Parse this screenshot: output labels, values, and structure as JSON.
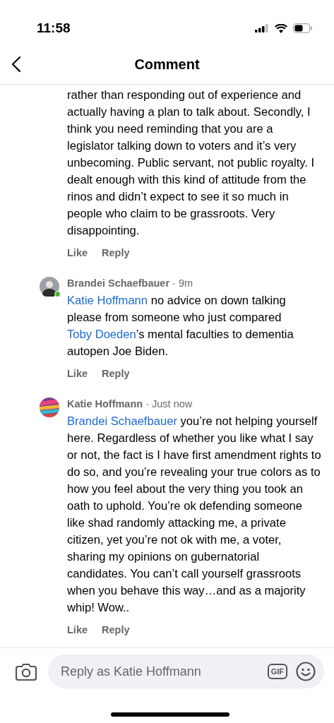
{
  "status_bar": {
    "time": "11:58"
  },
  "header": {
    "title": "Comment"
  },
  "comments": [
    {
      "body": [
        {
          "kind": "text",
          "text": "rather than responding out of experience and actually having a plan to talk about. Secondly, I think you need reminding that you are a legislator talking down to voters and it’s very unbecoming. Public servant, not public royalty. I dealt enough with this kind of attitude from the rinos and didn’t expect to see it so much in people who claim to be grassroots. Very disappointing."
        }
      ],
      "actions": [
        "Like",
        "Reply"
      ]
    },
    {
      "author": "Brandei Schaefbauer",
      "time": "· 9m",
      "online": true,
      "avatar": {
        "kind": "picture"
      },
      "body": [
        {
          "kind": "mention",
          "text": "Katie Hoffmann"
        },
        {
          "kind": "text",
          "text": " no advice on down talking please from someone who just compared "
        },
        {
          "kind": "mention",
          "text": "Toby Doeden"
        },
        {
          "kind": "text",
          "text": "’s mental faculties to dementia autopen Joe Biden."
        }
      ],
      "actions": [
        "Like",
        "Reply"
      ]
    },
    {
      "author": "Katie Hoffmann",
      "time": "· Just now",
      "online": false,
      "avatar": {
        "kind": "picture"
      },
      "body": [
        {
          "kind": "mention",
          "text": "Brandei Schaefbauer"
        },
        {
          "kind": "text",
          "text": " you’re not helping yourself here. Regardless of whether you like what I say or not, the fact is I have first amendment rights to do so, and you’re revealing your true colors as to how you feel about the very thing you took an oath to uphold. You’re ok defending someone like shad randomly attacking me, a private citizen, yet you’re not ok with me, a voter, sharing my opinions on gubernatorial candidates. You can’t call yourself grassroots when you behave this way…and as  a majority whip! Wow.."
        }
      ],
      "actions": [
        "Like",
        "Reply"
      ]
    }
  ],
  "reply_bar": {
    "placeholder": "Reply as Katie Hoffmann",
    "gif_label": "GIF"
  }
}
